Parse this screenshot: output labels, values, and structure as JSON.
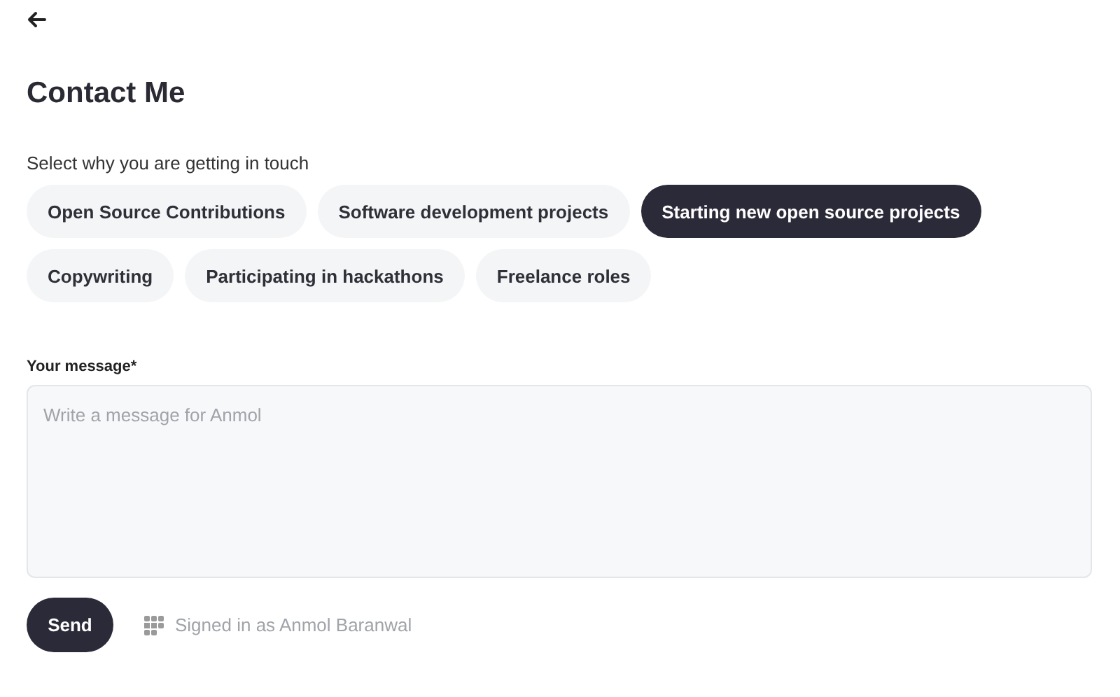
{
  "title": "Contact Me",
  "prompt": "Select why you are getting in touch",
  "reasons": [
    {
      "label": "Open Source Contributions",
      "selected": false
    },
    {
      "label": "Software development projects",
      "selected": false
    },
    {
      "label": "Starting new open source projects",
      "selected": true
    },
    {
      "label": "Copywriting",
      "selected": false
    },
    {
      "label": "Participating in hackathons",
      "selected": false
    },
    {
      "label": "Freelance roles",
      "selected": false
    }
  ],
  "message": {
    "label": "Your message*",
    "placeholder": "Write a message for Anmol"
  },
  "send_button": "Send",
  "signed_in": "Signed in as Anmol Baranwal"
}
